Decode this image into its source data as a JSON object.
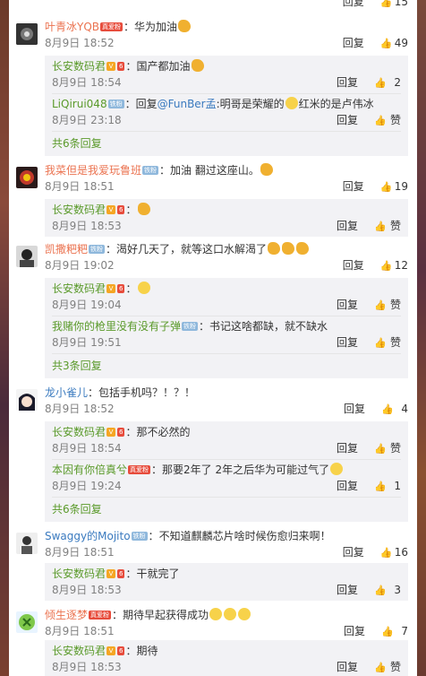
{
  "top_partial": {
    "reply": "回复",
    "likes": "15"
  },
  "comments": [
    {
      "user": "叶青冰YQB",
      "badge": "真爱粉",
      "text": "华为加油",
      "time": "8月9日 18:52",
      "reply": "回复",
      "likes": "49",
      "replies": [
        {
          "user": "长安数码君",
          "text": "国产都加油",
          "time": "8月9日 18:54",
          "reply": "回复",
          "likes": "2"
        },
        {
          "user": "LiQirui048",
          "badge": "铁粉",
          "text_prefix": "回复",
          "mention": "@FunBer孟",
          "text": ":明哥是荣耀的",
          "text2": "红米的是卢伟冰",
          "time": "8月9日 23:18",
          "reply": "回复",
          "likes": "赞"
        }
      ],
      "more": "共6条回复"
    },
    {
      "user": "我菜但是我爱玩鲁班",
      "badge": "铁粉",
      "text": "加油  翻过这座山。",
      "time": "8月9日 18:51",
      "reply": "回复",
      "likes": "19",
      "replies": [
        {
          "user": "长安数码君",
          "text": "",
          "time": "8月9日 18:53",
          "reply": "回复",
          "likes": "赞"
        }
      ]
    },
    {
      "user": "凯撒粑粑",
      "badge": "铁粉",
      "text": "渴好几天了，就等这口水解渴了",
      "time": "8月9日 19:02",
      "reply": "回复",
      "likes": "12",
      "replies": [
        {
          "user": "长安数码君",
          "text": "",
          "time": "8月9日 19:04",
          "reply": "回复",
          "likes": "赞"
        },
        {
          "user": "我赌你的枪里没有没有子弹",
          "badge": "铁粉",
          "text": "书记这啥都缺，就不缺水",
          "time": "8月9日 19:51",
          "reply": "回复",
          "likes": "赞"
        }
      ],
      "more": "共3条回复"
    },
    {
      "user": "龙小雀儿",
      "text": "包括手机吗？！？！",
      "time": "8月9日 18:52",
      "reply": "回复",
      "likes": "4",
      "replies": [
        {
          "user": "长安数码君",
          "text": "那不必然的",
          "time": "8月9日 18:54",
          "reply": "回复",
          "likes": "赞"
        },
        {
          "user": "本因有你倍真兮",
          "badge": "真爱粉",
          "text": "那要2年了  2年之后华为可能过气了",
          "time": "8月9日 19:24",
          "reply": "回复",
          "likes": "1"
        }
      ],
      "more": "共6条回复"
    },
    {
      "user": "Swaggy的Mojito",
      "badge": "铁粉",
      "text": "不知道麒麟芯片啥时候伤愈归来啊！",
      "time": "8月9日 18:51",
      "reply": "回复",
      "likes": "16",
      "replies": [
        {
          "user": "长安数码君",
          "text": "干就完了",
          "time": "8月9日 18:53",
          "reply": "回复",
          "likes": "3"
        }
      ]
    },
    {
      "user": "倾生逐梦",
      "badge": "真爱粉",
      "text": "期待早起获得成功",
      "time": "8月9日 18:51",
      "reply": "回复",
      "likes": "7",
      "replies": [
        {
          "user": "长安数码君",
          "text": "期待",
          "time": "8月9日 18:53",
          "reply": "回复",
          "likes": "赞"
        }
      ]
    }
  ]
}
